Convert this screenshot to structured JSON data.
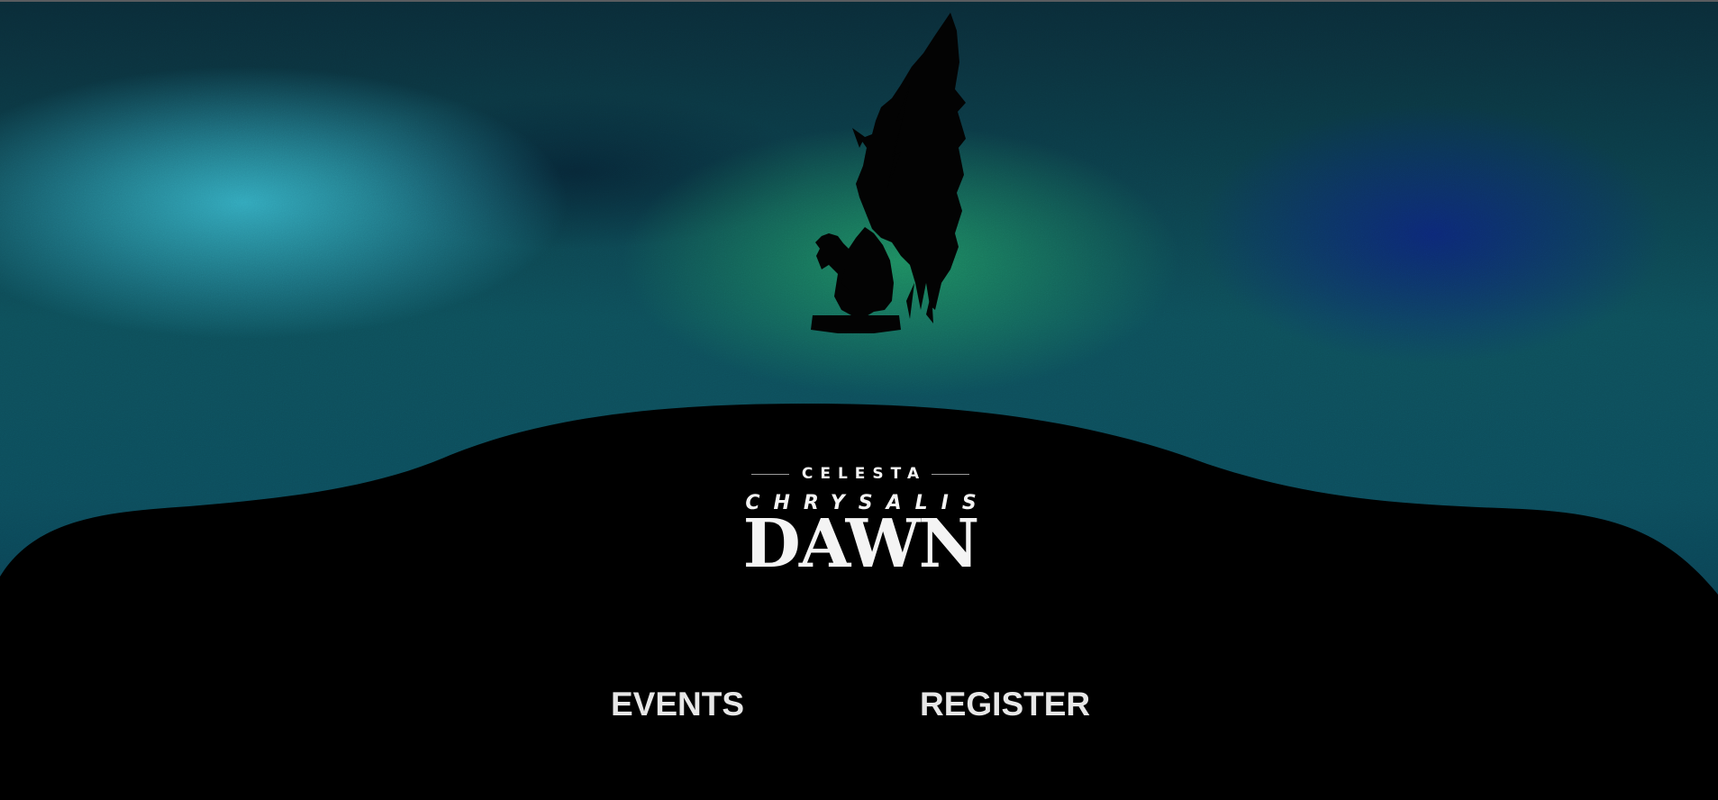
{
  "logo": {
    "eyebrow": "CELESTA",
    "subtitle": "CHRYSALIS",
    "title": "DAWN"
  },
  "nav": {
    "events_label": "EVENTS",
    "register_label": "REGISTER"
  },
  "colors": {
    "background": "#000000",
    "aurora_cyan": "#34acc0",
    "aurora_green": "#1e8e60",
    "aurora_blue": "#0c2678",
    "text": "#e7e7e7"
  },
  "icons": {
    "hero_figure": "winged-gargoyle-silhouette"
  }
}
